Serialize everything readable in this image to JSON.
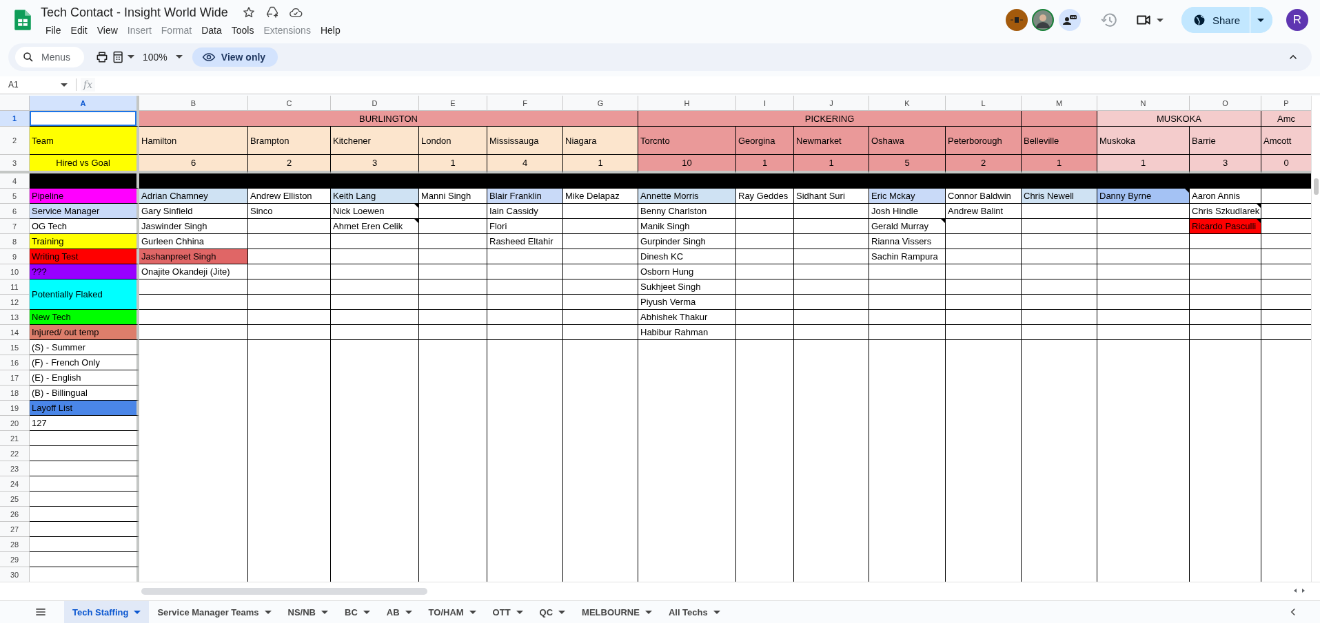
{
  "document": {
    "title": "Tech Contact - Insight World Wide"
  },
  "menu": [
    {
      "label": "File",
      "disabled": false
    },
    {
      "label": "Edit",
      "disabled": false
    },
    {
      "label": "View",
      "disabled": false
    },
    {
      "label": "Insert",
      "disabled": true
    },
    {
      "label": "Format",
      "disabled": true
    },
    {
      "label": "Data",
      "disabled": false
    },
    {
      "label": "Tools",
      "disabled": false
    },
    {
      "label": "Extensions",
      "disabled": true
    },
    {
      "label": "Help",
      "disabled": false
    }
  ],
  "share": {
    "label": "Share"
  },
  "account": {
    "initial": "R"
  },
  "toolbar": {
    "search_placeholder": "Menus",
    "zoom": "100%",
    "mode": "View only"
  },
  "formula_bar": {
    "cell_ref": "A1",
    "fx": "fx"
  },
  "grid": {
    "columns": [
      {
        "label": "A",
        "selected": true
      },
      {
        "label": "B",
        "selected": false
      },
      {
        "label": "C",
        "selected": false
      },
      {
        "label": "D",
        "selected": false
      },
      {
        "label": "E",
        "selected": false
      },
      {
        "label": "F",
        "selected": false
      },
      {
        "label": "G",
        "selected": false
      },
      {
        "label": "H",
        "selected": false
      },
      {
        "label": "I",
        "selected": false
      },
      {
        "label": "J",
        "selected": false
      },
      {
        "label": "K",
        "selected": false
      },
      {
        "label": "L",
        "selected": false
      },
      {
        "label": "M",
        "selected": false
      },
      {
        "label": "N",
        "selected": false
      },
      {
        "label": "O",
        "selected": false
      },
      {
        "label": "P",
        "selected": false
      }
    ],
    "rows": [
      {
        "label": "1",
        "selected": true,
        "kind": "region",
        "cells": [
          null,
          {
            "text": "BURLINGTON",
            "color": "#ea9999"
          },
          null,
          null,
          null,
          null,
          null,
          {
            "text": "PICKERING",
            "color": "#ea9999"
          },
          null,
          null,
          null,
          null,
          {
            "color": "#ea9999"
          },
          {
            "text": "MUSKOKA",
            "color": "#f4cccc"
          },
          null,
          {
            "text": "Amc",
            "color": "#f4cccc"
          }
        ]
      },
      {
        "label": "2",
        "selected": false,
        "kind": "city",
        "cells": [
          {
            "text": "Team",
            "color": "#ffff00"
          },
          {
            "text": "Hamilton",
            "color": "#fce5cd"
          },
          {
            "text": "Brampton",
            "color": "#fce5cd"
          },
          {
            "text": "Kitchener",
            "color": "#fce5cd"
          },
          {
            "text": "London",
            "color": "#fce5cd"
          },
          {
            "text": "Mississauga",
            "color": "#fce5cd"
          },
          {
            "text": "Niagara",
            "color": "#fce5cd"
          },
          {
            "text": "Torcnto",
            "color": "#ea9999"
          },
          {
            "text": "Georgina",
            "color": "#ea9999"
          },
          {
            "text": "Newmarket",
            "color": "#ea9999"
          },
          {
            "text": "Oshawa",
            "color": "#ea9999"
          },
          {
            "text": "Peterborough",
            "color": "#ea9999"
          },
          {
            "text": "Belleville",
            "color": "#ea9999"
          },
          {
            "text": "Muskoka",
            "color": "#f4cccc"
          },
          {
            "text": "Barrie",
            "color": "#f4cccc"
          },
          {
            "text": "Amcott",
            "color": "#f4cccc"
          }
        ]
      },
      {
        "label": "3",
        "selected": false,
        "kind": "count",
        "cells": [
          {
            "text": "Hired vs Goal",
            "color": "#ffff00"
          },
          {
            "text": "6",
            "color": "#fce5cd"
          },
          {
            "text": "2",
            "color": "#fce5cd"
          },
          {
            "text": "3",
            "color": "#fce5cd"
          },
          {
            "text": "1",
            "color": "#fce5cd"
          },
          {
            "text": "4",
            "color": "#fce5cd"
          },
          {
            "text": "1",
            "color": "#fce5cd"
          },
          {
            "text": "10",
            "color": "#ea9999"
          },
          {
            "text": "1",
            "color": "#ea9999"
          },
          {
            "text": "1",
            "color": "#ea9999"
          },
          {
            "text": "5",
            "color": "#ea9999"
          },
          {
            "text": "2",
            "color": "#ea9999"
          },
          {
            "text": "1",
            "color": "#ea9999"
          },
          {
            "text": "1",
            "color": "#f4cccc"
          },
          {
            "text": "3",
            "color": "#f4cccc"
          },
          {
            "text": "0",
            "color": "#f4cccc"
          }
        ]
      },
      {
        "label": "4",
        "selected": false,
        "kind": "band",
        "cells": [
          {
            "color": "#000000"
          },
          {
            "color": "#000000"
          },
          {
            "color": "#000000"
          },
          {
            "color": "#000000"
          },
          {
            "color": "#000000"
          },
          {
            "color": "#000000"
          },
          {
            "color": "#000000"
          },
          {
            "color": "#000000"
          },
          {
            "color": "#000000"
          },
          {
            "color": "#000000"
          },
          {
            "color": "#000000"
          },
          {
            "color": "#000000"
          },
          {
            "color": "#000000"
          },
          {
            "color": "#000000"
          },
          {
            "color": "#000000"
          },
          {
            "color": "#000000"
          }
        ]
      },
      {
        "label": "5",
        "selected": false,
        "kind": "entry",
        "cells": [
          {
            "text": "Pipeline",
            "color": "#ff00ff"
          },
          {
            "text": "Adrian Chamney",
            "color": "#cfe2f3"
          },
          {
            "text": "Andrew Elliston"
          },
          {
            "text": "Keith Lang",
            "color": "#cfe2f3"
          },
          {
            "text": "Manni Singh"
          },
          {
            "text": "Blair Franklin",
            "color": "#c9daf8"
          },
          {
            "text": "Mike Delapaz"
          },
          {
            "text": "Annette Morris",
            "color": "#cfe2f3"
          },
          {
            "text": "Ray Geddes"
          },
          {
            "text": "Sidhant Suri"
          },
          {
            "text": "Eric Mckay",
            "color": "#c9daf8"
          },
          {
            "text": "Connor Baldwin"
          },
          {
            "text": "Chris Newell",
            "color": "#cfe2f3"
          },
          {
            "text": "Danny Byrne",
            "color": "#a4c2f4",
            "note": true
          },
          {
            "text": "Aaron Annis"
          }
        ]
      },
      {
        "label": "6",
        "selected": false,
        "kind": "entry",
        "cells": [
          {
            "text": "Service Manager",
            "color": "#c9daf8"
          },
          {
            "text": "Gary Sinfield"
          },
          {
            "text": "Sinco"
          },
          {
            "text": "Nick Loewen",
            "note": true
          },
          null,
          {
            "text": "Iain Cassidy"
          },
          null,
          {
            "text": "Benny Charlston"
          },
          null,
          null,
          {
            "text": "Josh Hindle"
          },
          {
            "text": "Andrew Balint"
          },
          null,
          null,
          {
            "text": "Chris Szkudlarek",
            "note": true
          }
        ]
      },
      {
        "label": "7",
        "selected": false,
        "kind": "entry",
        "cells": [
          {
            "text": "OG Tech"
          },
          {
            "text": "Jaswinder Singh"
          },
          null,
          {
            "text": "Ahmet Eren Celik",
            "note": true
          },
          null,
          {
            "text": "Flori"
          },
          null,
          {
            "text": "Manik Singh"
          },
          null,
          null,
          {
            "text": "Gerald Murray",
            "note": true
          },
          null,
          null,
          null,
          {
            "text": "Ricardo Pasculli",
            "color": "#ff0000",
            "note": true
          }
        ]
      },
      {
        "label": "8",
        "selected": false,
        "kind": "entry",
        "cells": [
          {
            "text": "Training",
            "color": "#ffff00"
          },
          {
            "text": "Gurleen Chhina"
          },
          null,
          null,
          null,
          {
            "text": "Rasheed Eltahir"
          },
          null,
          {
            "text": "Gurpinder Singh"
          },
          null,
          null,
          {
            "text": "Rianna Vissers"
          }
        ]
      },
      {
        "label": "9",
        "selected": false,
        "kind": "entry",
        "cells": [
          {
            "text": "Writing Test",
            "color": "#ff0000"
          },
          {
            "text": "Jashanpreet Singh",
            "color": "#e06666"
          },
          null,
          null,
          null,
          null,
          null,
          {
            "text": "Dinesh KC"
          },
          null,
          null,
          {
            "text": "Sachin Rampura"
          }
        ]
      },
      {
        "label": "10",
        "selected": false,
        "kind": "entry",
        "cells": [
          {
            "text": "???",
            "color": "#9900ff"
          },
          {
            "text": "Onajite Okandeji (Jite)"
          },
          null,
          null,
          null,
          null,
          null,
          {
            "text": "Osborn Hung"
          }
        ]
      },
      {
        "label": "11",
        "selected": false,
        "kind": "entry",
        "cells": [
          {
            "text": "Potentially Flaked",
            "color": "#00ffff"
          },
          null,
          null,
          null,
          null,
          null,
          null,
          {
            "text": "Sukhjeet Singh"
          }
        ]
      },
      {
        "label": "12",
        "selected": false,
        "kind": "entry",
        "cells": [
          {
            "merge_up": true
          },
          null,
          null,
          null,
          null,
          null,
          null,
          {
            "text": "Piyush Verma"
          }
        ]
      },
      {
        "label": "13",
        "selected": false,
        "kind": "entry",
        "cells": [
          {
            "text": "New Tech",
            "color": "#00ff00"
          },
          null,
          null,
          null,
          null,
          null,
          null,
          {
            "text": "Abhishek Thakur"
          }
        ]
      },
      {
        "label": "14",
        "selected": false,
        "kind": "entry",
        "cells": [
          {
            "text": "Injured/ out temp",
            "color": "#dd7e6b"
          },
          null,
          null,
          null,
          null,
          null,
          null,
          {
            "text": "Habibur Rahman"
          }
        ]
      },
      {
        "label": "15",
        "selected": false,
        "kind": "legend",
        "cells": [
          {
            "text": "(S) - Summer"
          }
        ]
      },
      {
        "label": "16",
        "selected": false,
        "kind": "legend",
        "cells": [
          {
            "text": "(F) - French Only"
          }
        ]
      },
      {
        "label": "17",
        "selected": false,
        "kind": "legend",
        "cells": [
          {
            "text": "(E) - English"
          }
        ]
      },
      {
        "label": "18",
        "selected": false,
        "kind": "legend",
        "cells": [
          {
            "text": "(B) - Billingual"
          }
        ]
      },
      {
        "label": "19",
        "selected": false,
        "kind": "legend",
        "cells": [
          {
            "text": "Layoff List",
            "color": "#4a86e8"
          }
        ]
      },
      {
        "label": "20",
        "selected": false,
        "kind": "legend",
        "cells": [
          {
            "text": "127"
          }
        ]
      },
      {
        "label": "21",
        "selected": false,
        "kind": "legend"
      },
      {
        "label": "22",
        "selected": false,
        "kind": "legend"
      },
      {
        "label": "23",
        "selected": false,
        "kind": "legend"
      },
      {
        "label": "24",
        "selected": false,
        "kind": "legend"
      },
      {
        "label": "25",
        "selected": false,
        "kind": "legend"
      },
      {
        "label": "26",
        "selected": false,
        "kind": "legend"
      },
      {
        "label": "27",
        "selected": false,
        "kind": "legend"
      },
      {
        "label": "28",
        "selected": false,
        "kind": "legend"
      },
      {
        "label": "29",
        "selected": false,
        "kind": "legend"
      },
      {
        "label": "30",
        "selected": false,
        "kind": "legend"
      }
    ]
  },
  "sheet_tabs": [
    {
      "label": "Tech Staffing",
      "selected": true
    },
    {
      "label": "Service Manager Teams",
      "selected": false
    },
    {
      "label": "NS/NB",
      "selected": false
    },
    {
      "label": "BC",
      "selected": false
    },
    {
      "label": "AB",
      "selected": false
    },
    {
      "label": "TO/HAM",
      "selected": false
    },
    {
      "label": "OTT",
      "selected": false
    },
    {
      "label": "QC",
      "selected": false
    },
    {
      "label": "MELBOURNE",
      "selected": false
    },
    {
      "label": "All Techs",
      "selected": false
    }
  ]
}
